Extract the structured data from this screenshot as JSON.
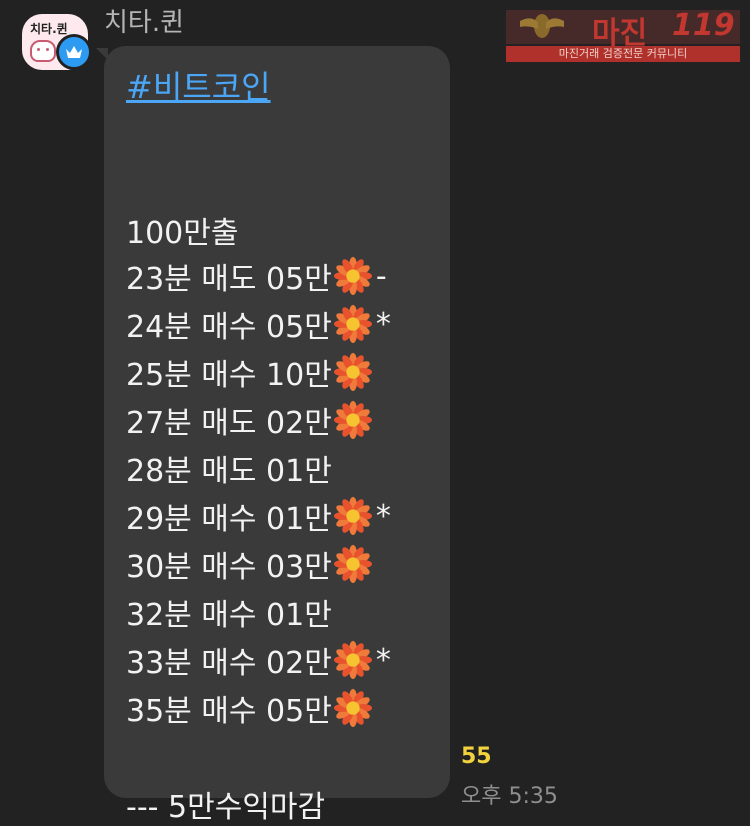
{
  "chat": {
    "sender_name": "치타.퀸",
    "avatar_text": "치타.퀸",
    "watermark": {
      "title": "마진",
      "number": "119",
      "subtitle": "마진거래 검증전문 커뮤니티"
    },
    "message": {
      "hashtag": "#비트코인",
      "headline": "100만출",
      "lines": [
        {
          "text": "23분 매도 05만",
          "flower": true,
          "suffix": "-"
        },
        {
          "text": "24분 매수 05만",
          "flower": true,
          "suffix": "*"
        },
        {
          "text": "25분 매수 10만",
          "flower": true,
          "suffix": ""
        },
        {
          "text": "27분 매도 02만",
          "flower": true,
          "suffix": ""
        },
        {
          "text": "28분 매도 01만",
          "flower": false,
          "suffix": ""
        },
        {
          "text": "29분 매수 01만",
          "flower": true,
          "suffix": "*"
        },
        {
          "text": "30분 매수 03만",
          "flower": true,
          "suffix": ""
        },
        {
          "text": "32분 매수 01만",
          "flower": false,
          "suffix": ""
        },
        {
          "text": "33분 매수 02만",
          "flower": true,
          "suffix": "*"
        },
        {
          "text": "35분 매수 05만",
          "flower": true,
          "suffix": ""
        }
      ],
      "closing": "--- 5만수익마감",
      "unread_count": "55",
      "time": "오후 5:35"
    },
    "colors": {
      "background": "#222223",
      "bubble": "#3a3a3b",
      "hashtag_link": "#4ba6f5",
      "unread": "#f2d33d",
      "badge": "#2e9bf2"
    },
    "icons": {
      "flower": "sunflower-emoji-icon",
      "badge": "crown-icon"
    }
  }
}
